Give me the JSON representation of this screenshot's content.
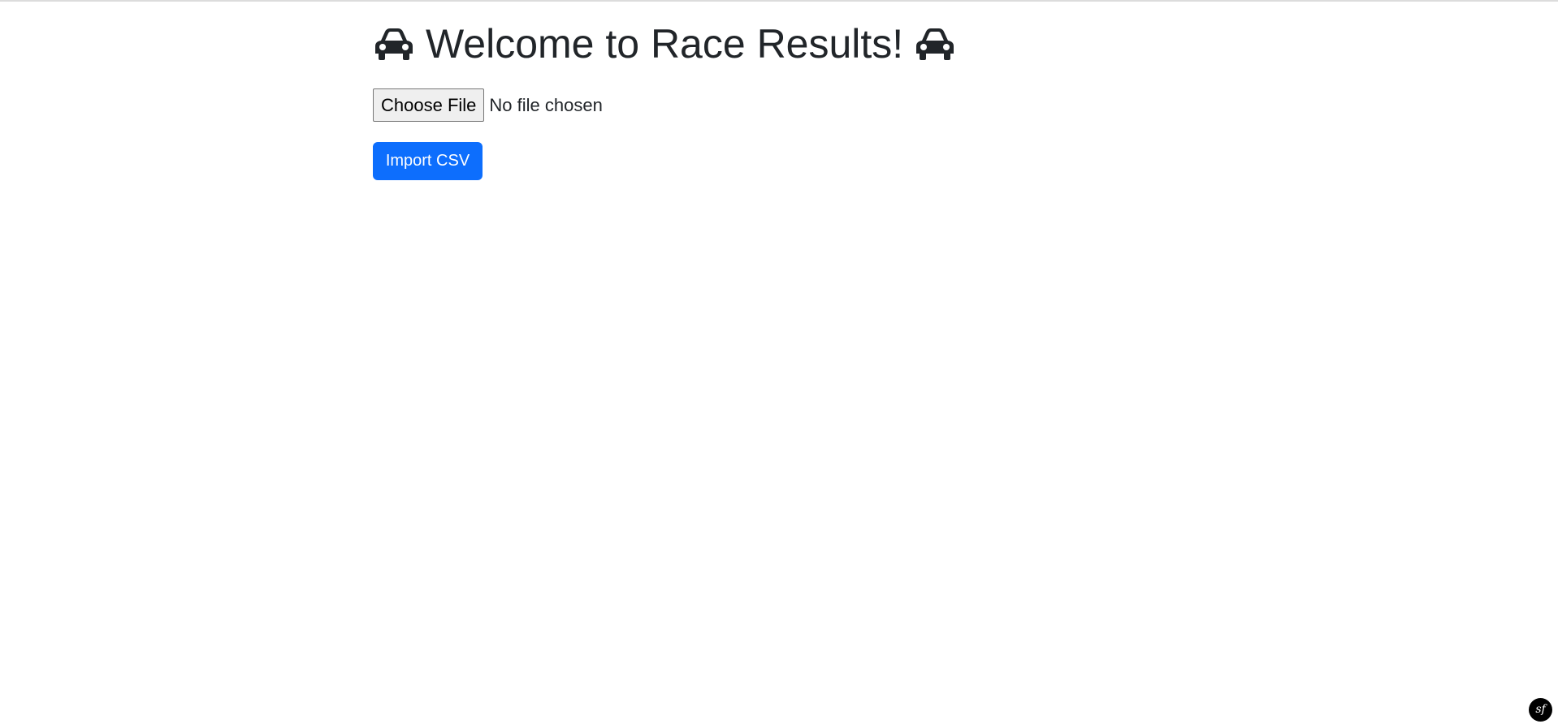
{
  "page": {
    "title": "Welcome to Race Results!",
    "title_icon": "car-icon"
  },
  "file_input": {
    "button_label": "Choose File",
    "status_text": "No file chosen"
  },
  "actions": {
    "import_label": "Import CSV"
  },
  "toolbar": {
    "badge_text": "sf",
    "badge_icon": "symfony-logo-icon"
  },
  "colors": {
    "text": "#212529",
    "primary": "#0d6efd",
    "badge_bg": "#000000"
  }
}
